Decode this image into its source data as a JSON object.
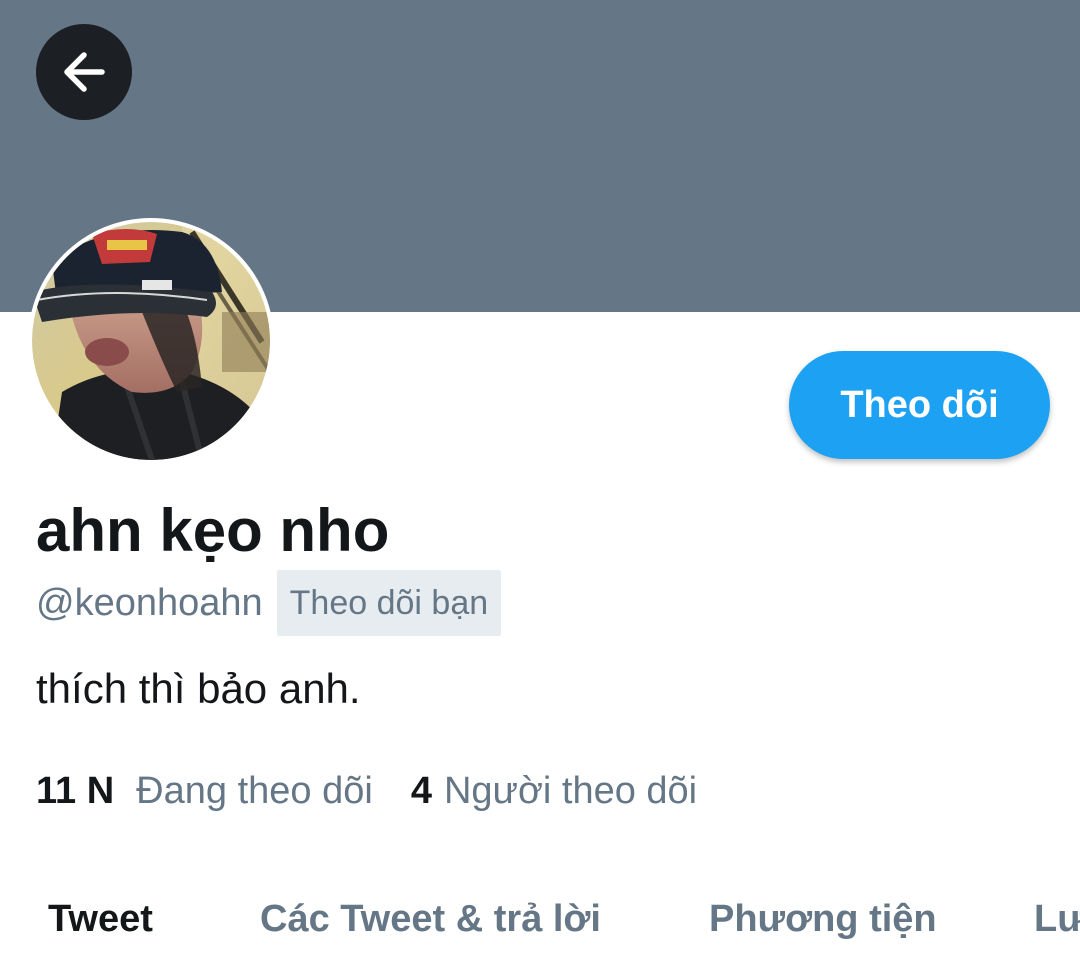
{
  "header": {
    "back_icon": "arrow-left-icon",
    "banner_color": "#657786"
  },
  "profile": {
    "display_name": "ahn kẹo nho",
    "handle": "@keonhoahn",
    "follows_you_badge": "Theo dõi bạn",
    "bio": "thích thì bảo anh.",
    "follow_button_label": "Theo dõi",
    "accent_color": "#1da1f2"
  },
  "stats": {
    "following_count": "11 N",
    "following_label": "Đang theo dõi",
    "followers_count": "4",
    "followers_label": "Người theo dõi"
  },
  "tabs": [
    {
      "label": "Tweet",
      "active": true
    },
    {
      "label": "Các Tweet & trả lời",
      "active": false
    },
    {
      "label": "Phương tiện",
      "active": false
    },
    {
      "label": "Lượt thích",
      "active": false
    }
  ]
}
